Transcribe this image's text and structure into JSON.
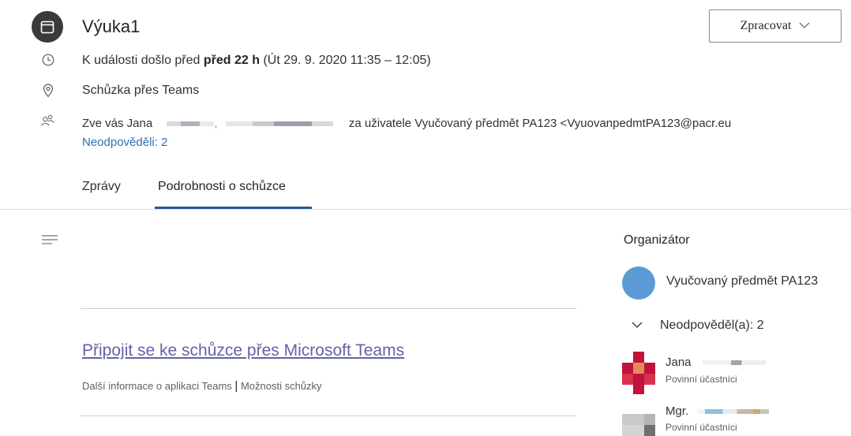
{
  "event": {
    "title": "Výuka1",
    "respond_label": "Zpracovat",
    "time_prefix": "K události došlo před ",
    "time_bold": "před 22 h",
    "time_suffix": " (Út 29. 9. 2020 11:35 – 12:05)",
    "location": "Schůzka přes Teams",
    "invite_prefix": "Zve vás Jana",
    "invite_suffix": "za uživatele Vyučovaný předmět PA123 <VyuovanpedmtPA123@pacr.eu",
    "no_response": "Neodpověděli: 2"
  },
  "tabs": [
    {
      "label": "Zprávy",
      "active": false
    },
    {
      "label": "Podrobnosti o schůzce",
      "active": true
    }
  ],
  "body": {
    "join_link": "Připojit se ke schůzce přes Microsoft Teams",
    "more_info": "Další informace o aplikaci Teams",
    "separator": "|",
    "options": "Možnosti schůzky"
  },
  "sidebar": {
    "organizer_heading": "Organizátor",
    "organizer_name": "Vyučovaný předmět PA123",
    "no_response_group": "Neodpověděl(a): 2",
    "attendees": [
      {
        "name": "Jana",
        "role": "Povinní účastníci"
      },
      {
        "name": "Mgr.",
        "role": "Povinní účastníci"
      }
    ]
  },
  "colors": {
    "accent": "#2b579a",
    "link": "#2f6db5",
    "teams_link": "#6264a7",
    "organizer_avatar": "#5b9bd5"
  },
  "icons": [
    "calendar-icon",
    "clock-icon",
    "location-pin-icon",
    "people-icon",
    "chevron-down-icon",
    "hamburger-icon"
  ]
}
